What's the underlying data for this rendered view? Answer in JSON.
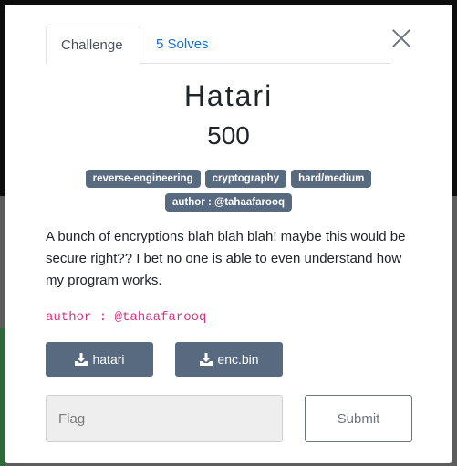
{
  "tabs": [
    {
      "label": "Challenge",
      "active": true
    },
    {
      "label": "5 Solves",
      "active": false
    }
  ],
  "challenge": {
    "name": "Hatari",
    "value": "500",
    "tags_row1": [
      "reverse-engineering",
      "cryptography",
      "hard/medium"
    ],
    "tags_row2": [
      "author : @tahaafarooq"
    ],
    "description": "A bunch of encryptions blah blah blah! maybe this would be secure right?? I bet no one is able to even understand how my program works.",
    "author_line": "author : @tahaafarooq"
  },
  "files": [
    {
      "label": "hatari",
      "icon": "download-icon"
    },
    {
      "label": "enc.bin",
      "icon": "download-icon"
    }
  ],
  "form": {
    "flag_placeholder": "Flag",
    "flag_value": "",
    "submit_label": "Submit"
  },
  "colors": {
    "tag_bg": "#576a80",
    "link": "#0f72d1",
    "author_code": "#d63384"
  }
}
